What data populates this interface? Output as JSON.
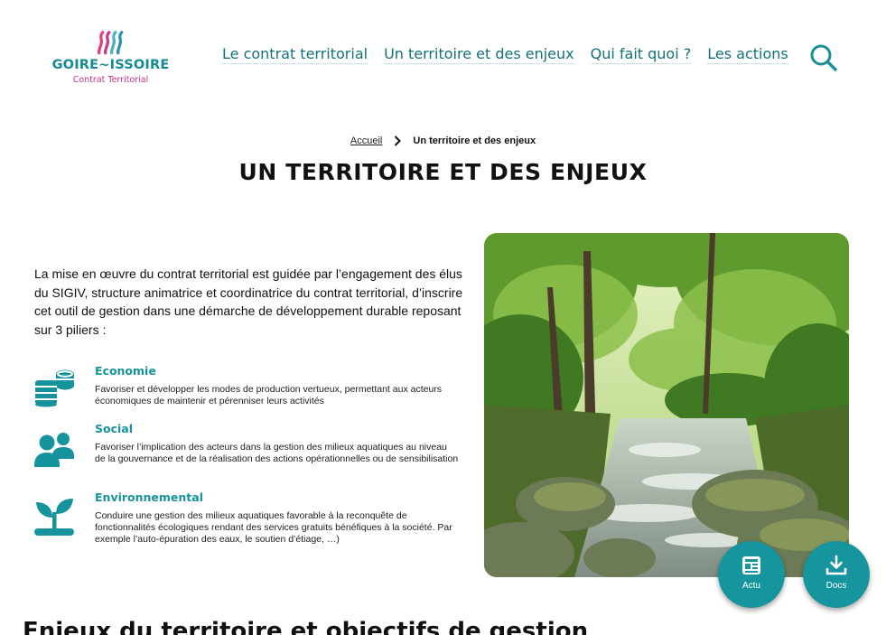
{
  "logo": {
    "title": "GOIRE~ISSOIRE",
    "subtitle": "Contrat Territorial"
  },
  "nav": {
    "items": [
      {
        "label": "Le contrat territorial"
      },
      {
        "label": "Un territoire et des enjeux"
      },
      {
        "label": "Qui fait quoi ?"
      },
      {
        "label": "Les actions"
      }
    ],
    "search_icon": "search-icon"
  },
  "breadcrumb": {
    "home": "Accueil",
    "current": "Un territoire et des enjeux"
  },
  "page": {
    "title": "UN TERRITOIRE ET DES ENJEUX",
    "intro": "La mise en œuvre du contrat territorial est guidée par l’engagement des élus du SIGIV, structure animatrice et coordinatrice du contrat territorial, d’inscrire cet outil de gestion dans une démarche de développement durable reposant sur 3 piliers :"
  },
  "pillars": [
    {
      "icon": "coins-icon",
      "title": "Economie",
      "desc": "Favoriser et développer les modes de production vertueux, permettant aux acteurs économiques de maintenir et pérenniser leurs activités"
    },
    {
      "icon": "people-icon",
      "title": "Social",
      "desc": "Favoriser l’implication des acteurs dans la gestion des milieux aquatiques au niveau de la gouvernance et de la réalisation des actions opérationnelles ou de sensibilisation"
    },
    {
      "icon": "seedling-icon",
      "title": "Environnemental",
      "desc": "Conduire une gestion des milieux aquatiques favorable à la reconquête de fonctionnalités écologiques rendant des services gratuits bénéfiques à la société. Par exemple l’auto-épuration des eaux, le soutien d’étiage, …)"
    }
  ],
  "fabs": {
    "news_label": "Actu",
    "docs_label": "Docs"
  },
  "section": {
    "title": "Enjeux du territoire et objectifs de gestion"
  },
  "colors": {
    "accent": "#17959e",
    "nav_text": "#13707a",
    "brand_pink": "#c2377f"
  }
}
